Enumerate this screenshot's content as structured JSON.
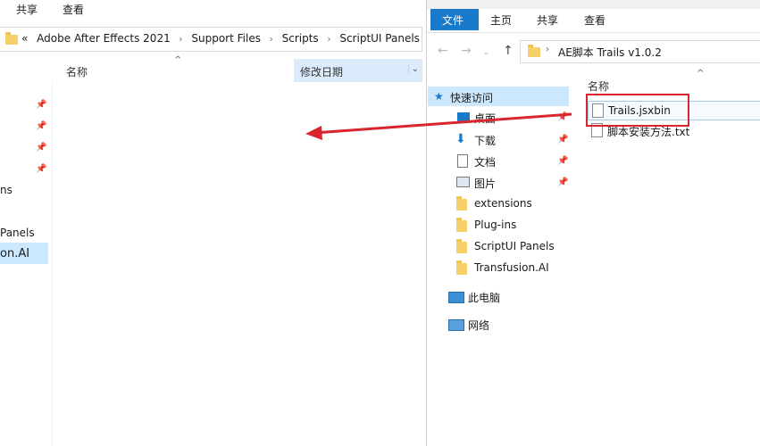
{
  "left_window": {
    "ribbon": {
      "share": "共享",
      "view": "查看"
    },
    "breadcrumb": [
      "«",
      "Adobe After Effects 2021",
      "Support Files",
      "Scripts",
      "ScriptUI Panels"
    ],
    "columns": {
      "name": "名称",
      "date_modified": "修改日期"
    },
    "nav_items": [
      "ns",
      "Panels",
      "on.AI"
    ]
  },
  "right_window": {
    "ribbon": {
      "file": "文件",
      "home": "主页",
      "share": "共享",
      "view": "查看"
    },
    "address": {
      "path": "AE脚本 Trails v1.0.2"
    },
    "nav": {
      "quick_access": "快速访问",
      "desktop": "桌面",
      "downloads": "下载",
      "documents": "文档",
      "pictures": "图片",
      "extensions": "extensions",
      "plugins": "Plug-ins",
      "scriptui": "ScriptUI Panels",
      "transfusion": "Transfusion.AI",
      "this_pc": "此电脑",
      "network": "网络"
    },
    "columns": {
      "name": "名称"
    },
    "files": [
      {
        "name": "Trails.jsxbin"
      },
      {
        "name": "脚本安装方法.txt"
      }
    ]
  },
  "colors": {
    "accent": "#1979ca",
    "selection": "#cce8ff",
    "arrow": "#d9262e",
    "folder": "#f5cf6a"
  }
}
